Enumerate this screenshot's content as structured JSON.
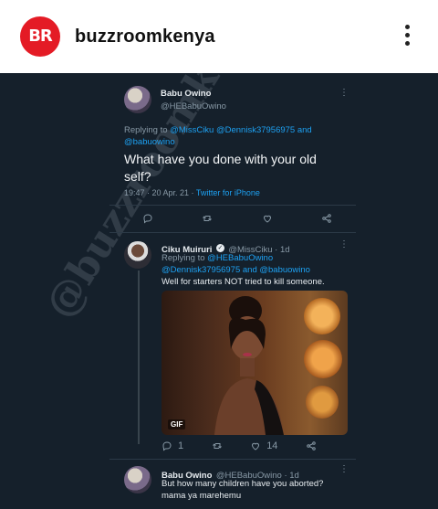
{
  "header": {
    "logo_text": "BR",
    "username": "buzzroomkenya"
  },
  "watermark": "@buzzroomkenya",
  "tweet_main": {
    "name": "Babu Owino",
    "handle": "@HEBabuOwino",
    "replying_prefix": "Replying to",
    "replying_line1": "@MissCiku @Dennisk37956975 and",
    "replying_line2": "@babuowino",
    "text_line1": "What have you done with your old",
    "text_line2": "self?",
    "timestamp": "19:47 · 20 Apr. 21 ·",
    "source": "Twitter for iPhone"
  },
  "tweet_reply": {
    "name": "Ciku Muiruri",
    "verified": true,
    "handle_time": "@MissCiku · 1d",
    "replying_prefix": "Replying to",
    "replying_line1": "@HEBabuOwino",
    "replying_line2": "@Dennisk37956975 and @babuowino",
    "text": "Well for starters NOT tried to kill someone.",
    "gif_label": "GIF",
    "reply_count": "1",
    "like_count": "14"
  },
  "tweet_third": {
    "name": "Babu Owino",
    "handle_time": "@HEBabuOwino · 1d",
    "text_line1": "But how many children have you aborted?",
    "text_line2": "mama ya marehemu"
  },
  "colors": {
    "background": "#15202b",
    "link": "#1da1f2",
    "brand": "#e41b25"
  }
}
